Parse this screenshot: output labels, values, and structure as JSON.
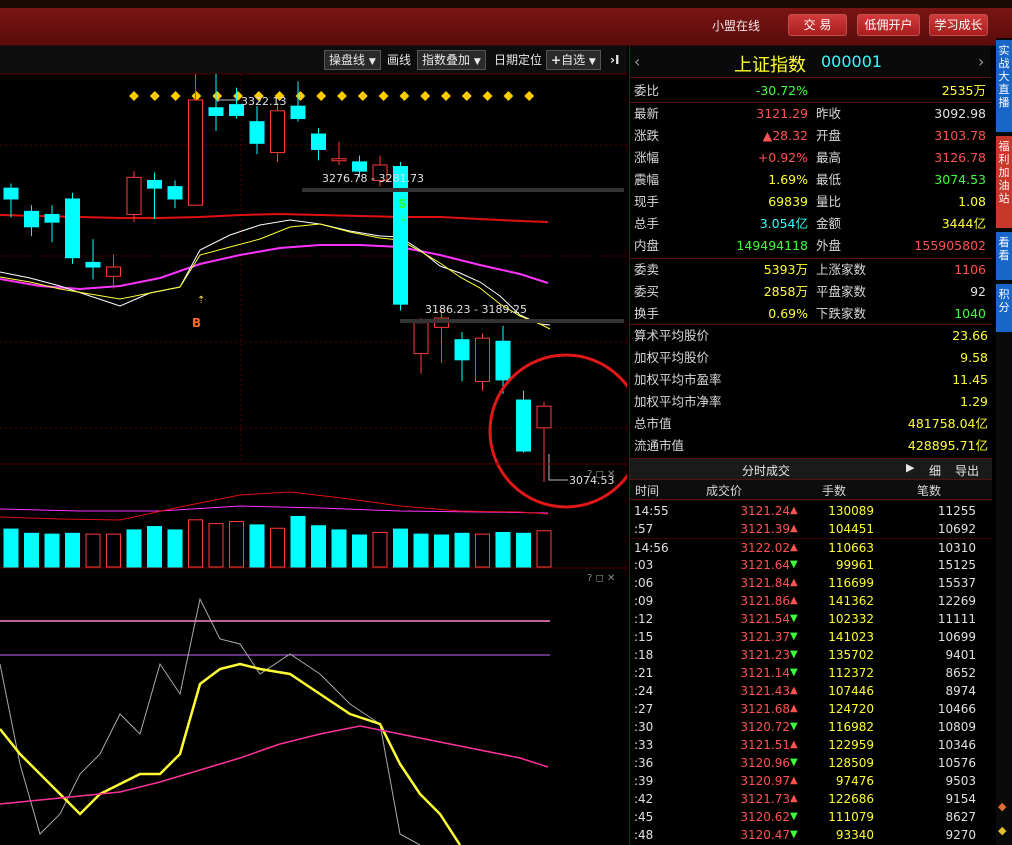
{
  "titlebar": {
    "status": "小盟在线",
    "buttons": [
      "交 易",
      "低佣开户",
      "学习成长"
    ]
  },
  "toolbar": {
    "items": [
      "操盘线",
      "画线",
      "指数叠加",
      "日期定位",
      "自选"
    ]
  },
  "chart": {
    "annotations": {
      "high": "3322.13",
      "gap1": "3276.78 - 3281.73",
      "gap2": "3186.23 - 3189.25",
      "low": "3074.53",
      "buy_marker": "B",
      "sell_marker": "S"
    }
  },
  "quote": {
    "name": "上证指数",
    "code": "000001",
    "weibi_label": "委比",
    "weibi_value": "-30.72%",
    "weibi_amount": "2535万",
    "grid": [
      {
        "l1": "最新",
        "v1": "3121.29",
        "c1": "r",
        "l2": "昨收",
        "v2": "3092.98",
        "c2": "w"
      },
      {
        "l1": "涨跌",
        "v1": "▲28.32",
        "c1": "r",
        "l2": "开盘",
        "v2": "3103.78",
        "c2": "r"
      },
      {
        "l1": "涨幅",
        "v1": "+0.92%",
        "c1": "r",
        "l2": "最高",
        "v2": "3126.78",
        "c2": "r"
      },
      {
        "l1": "震幅",
        "v1": "1.69%",
        "c1": "y",
        "l2": "最低",
        "v2": "3074.53",
        "c2": "g"
      },
      {
        "l1": "现手",
        "v1": "69839",
        "c1": "y",
        "l2": "量比",
        "v2": "1.08",
        "c2": "y"
      },
      {
        "l1": "总手",
        "v1": "3.054亿",
        "c1": "c",
        "l2": "金额",
        "v2": "3444亿",
        "c2": "y"
      },
      {
        "l1": "内盘",
        "v1": "149494118",
        "c1": "g",
        "l2": "外盘",
        "v2": "155905802",
        "c2": "r"
      }
    ],
    "grid2": [
      {
        "l1": "委卖",
        "v1": "5393万",
        "c1": "y",
        "l2": "上涨家数",
        "v2": "1106",
        "c2": "r"
      },
      {
        "l1": "委买",
        "v1": "2858万",
        "c1": "y",
        "l2": "平盘家数",
        "v2": "92",
        "c2": "w"
      },
      {
        "l1": "换手",
        "v1": "0.69%",
        "c1": "y",
        "l2": "下跌家数",
        "v2": "1040",
        "c2": "g"
      }
    ],
    "stats": [
      {
        "label": "算术平均股价",
        "value": "23.66"
      },
      {
        "label": "加权平均股价",
        "value": "9.58"
      },
      {
        "label": "加权平均市盈率",
        "value": "11.45"
      },
      {
        "label": "加权平均市净率",
        "value": "1.29"
      },
      {
        "label": "总市值",
        "value": "481758.04亿"
      },
      {
        "label": "流通市值",
        "value": "428895.71亿"
      }
    ]
  },
  "ticks": {
    "title": "分时成交",
    "detail": "细",
    "export": "导出",
    "headers": [
      "时间",
      "成交价",
      "手数",
      "笔数"
    ],
    "rows": [
      {
        "t": "14:55",
        "p": "3121.24",
        "d": "up",
        "v": "130089",
        "n": "11255"
      },
      {
        "t": ":57",
        "p": "3121.39",
        "d": "up",
        "v": "104451",
        "n": "10692"
      },
      {
        "t": "14:56",
        "p": "3122.02",
        "d": "up",
        "v": "110663",
        "n": "10310"
      },
      {
        "t": ":03",
        "p": "3121.64",
        "d": "down",
        "v": "99961",
        "n": "15125"
      },
      {
        "t": ":06",
        "p": "3121.84",
        "d": "up",
        "v": "116699",
        "n": "15537"
      },
      {
        "t": ":09",
        "p": "3121.86",
        "d": "up",
        "v": "141362",
        "n": "12269"
      },
      {
        "t": ":12",
        "p": "3121.54",
        "d": "down",
        "v": "102332",
        "n": "11111"
      },
      {
        "t": ":15",
        "p": "3121.37",
        "d": "down",
        "v": "141023",
        "n": "10699"
      },
      {
        "t": ":18",
        "p": "3121.23",
        "d": "down",
        "v": "135702",
        "n": "9401"
      },
      {
        "t": ":21",
        "p": "3121.14",
        "d": "down",
        "v": "112372",
        "n": "8652"
      },
      {
        "t": ":24",
        "p": "3121.43",
        "d": "up",
        "v": "107446",
        "n": "8974"
      },
      {
        "t": ":27",
        "p": "3121.68",
        "d": "up",
        "v": "124720",
        "n": "10466"
      },
      {
        "t": ":30",
        "p": "3120.72",
        "d": "down",
        "v": "116982",
        "n": "10809"
      },
      {
        "t": ":33",
        "p": "3121.51",
        "d": "up",
        "v": "122959",
        "n": "10346"
      },
      {
        "t": ":36",
        "p": "3120.96",
        "d": "down",
        "v": "128509",
        "n": "10576"
      },
      {
        "t": ":39",
        "p": "3120.97",
        "d": "up",
        "v": "97476",
        "n": "9503"
      },
      {
        "t": ":42",
        "p": "3121.73",
        "d": "up",
        "v": "122686",
        "n": "9154"
      },
      {
        "t": ":45",
        "p": "3120.62",
        "d": "down",
        "v": "111079",
        "n": "8627"
      },
      {
        "t": ":48",
        "p": "3120.47",
        "d": "down",
        "v": "93340",
        "n": "9270"
      }
    ]
  },
  "sidebar": {
    "tabs": [
      "实战大直播",
      "福利加油站",
      "看看",
      "积分"
    ]
  },
  "colors": {
    "up": "#ff3a3a",
    "down": "#00ffff",
    "ma_white": "#ffffff",
    "ma_yellow": "#ffff33",
    "ma_magenta": "#ff33ff",
    "ma_red": "#e01010"
  },
  "chart_data": [
    {
      "type": "candlestick",
      "candles": [
        {
          "o": 3265,
          "c": 3258,
          "h": 3268,
          "l": 3246
        },
        {
          "o": 3250,
          "c": 3240,
          "h": 3254,
          "l": 3234
        },
        {
          "o": 3248,
          "c": 3243,
          "h": 3254,
          "l": 3230
        },
        {
          "o": 3258,
          "c": 3220,
          "h": 3262,
          "l": 3216
        },
        {
          "o": 3217,
          "c": 3214,
          "h": 3232,
          "l": 3206
        },
        {
          "o": 3208,
          "c": 3214,
          "h": 3222,
          "l": 3200
        },
        {
          "o": 3248,
          "c": 3272,
          "h": 3276,
          "l": 3243
        },
        {
          "o": 3270,
          "c": 3265,
          "h": 3275,
          "l": 3245
        },
        {
          "o": 3266,
          "c": 3258,
          "h": 3270,
          "l": 3252
        },
        {
          "o": 3254,
          "c": 3322,
          "h": 3342,
          "l": 3254
        },
        {
          "o": 3317,
          "c": 3312,
          "h": 3342,
          "l": 3302
        },
        {
          "o": 3319,
          "c": 3312,
          "h": 3330,
          "l": 3310
        },
        {
          "o": 3308,
          "c": 3294,
          "h": 3318,
          "l": 3287
        },
        {
          "o": 3288,
          "c": 3315,
          "h": 3320,
          "l": 3282
        },
        {
          "o": 3318,
          "c": 3310,
          "h": 3334,
          "l": 3308
        },
        {
          "o": 3300,
          "c": 3290,
          "h": 3304,
          "l": 3283
        },
        {
          "o": 3284,
          "c": 3284,
          "h": 3295,
          "l": 3280
        },
        {
          "o": 3282,
          "c": 3276,
          "h": 3286,
          "l": 3272
        },
        {
          "o": 3270,
          "c": 3280,
          "h": 3286,
          "l": 3266
        },
        {
          "o": 3279,
          "c": 3190,
          "h": 3282,
          "l": 3186
        },
        {
          "o": 3158,
          "c": 3178,
          "h": 3181,
          "l": 3145
        },
        {
          "o": 3175,
          "c": 3181,
          "h": 3186,
          "l": 3152
        },
        {
          "o": 3167,
          "c": 3154,
          "h": 3172,
          "l": 3140
        },
        {
          "o": 3140,
          "c": 3168,
          "h": 3171,
          "l": 3134
        },
        {
          "o": 3166,
          "c": 3141,
          "h": 3176,
          "l": 3132
        },
        {
          "o": 3128,
          "c": 3095,
          "h": 3134,
          "l": 3094
        },
        {
          "o": 3110,
          "c": 3124,
          "h": 3127,
          "l": 3075
        }
      ]
    },
    {
      "type": "bar",
      "volumes": [
        {
          "v": 0.9,
          "up": false
        },
        {
          "v": 0.8,
          "up": false
        },
        {
          "v": 0.78,
          "up": false
        },
        {
          "v": 0.8,
          "up": false
        },
        {
          "v": 0.78,
          "up": true
        },
        {
          "v": 0.78,
          "up": true
        },
        {
          "v": 0.88,
          "up": false
        },
        {
          "v": 0.96,
          "up": false
        },
        {
          "v": 0.88,
          "up": false
        },
        {
          "v": 1.12,
          "up": true
        },
        {
          "v": 1.03,
          "up": true
        },
        {
          "v": 1.08,
          "up": true
        },
        {
          "v": 1.0,
          "up": false
        },
        {
          "v": 0.92,
          "up": true
        },
        {
          "v": 1.2,
          "up": false
        },
        {
          "v": 0.98,
          "up": false
        },
        {
          "v": 0.88,
          "up": false
        },
        {
          "v": 0.76,
          "up": false
        },
        {
          "v": 0.82,
          "up": true
        },
        {
          "v": 0.9,
          "up": false
        },
        {
          "v": 0.78,
          "up": false
        },
        {
          "v": 0.76,
          "up": false
        },
        {
          "v": 0.8,
          "up": false
        },
        {
          "v": 0.78,
          "up": true
        },
        {
          "v": 0.82,
          "up": false
        },
        {
          "v": 0.8,
          "up": false
        },
        {
          "v": 0.86,
          "up": true
        }
      ]
    }
  ]
}
